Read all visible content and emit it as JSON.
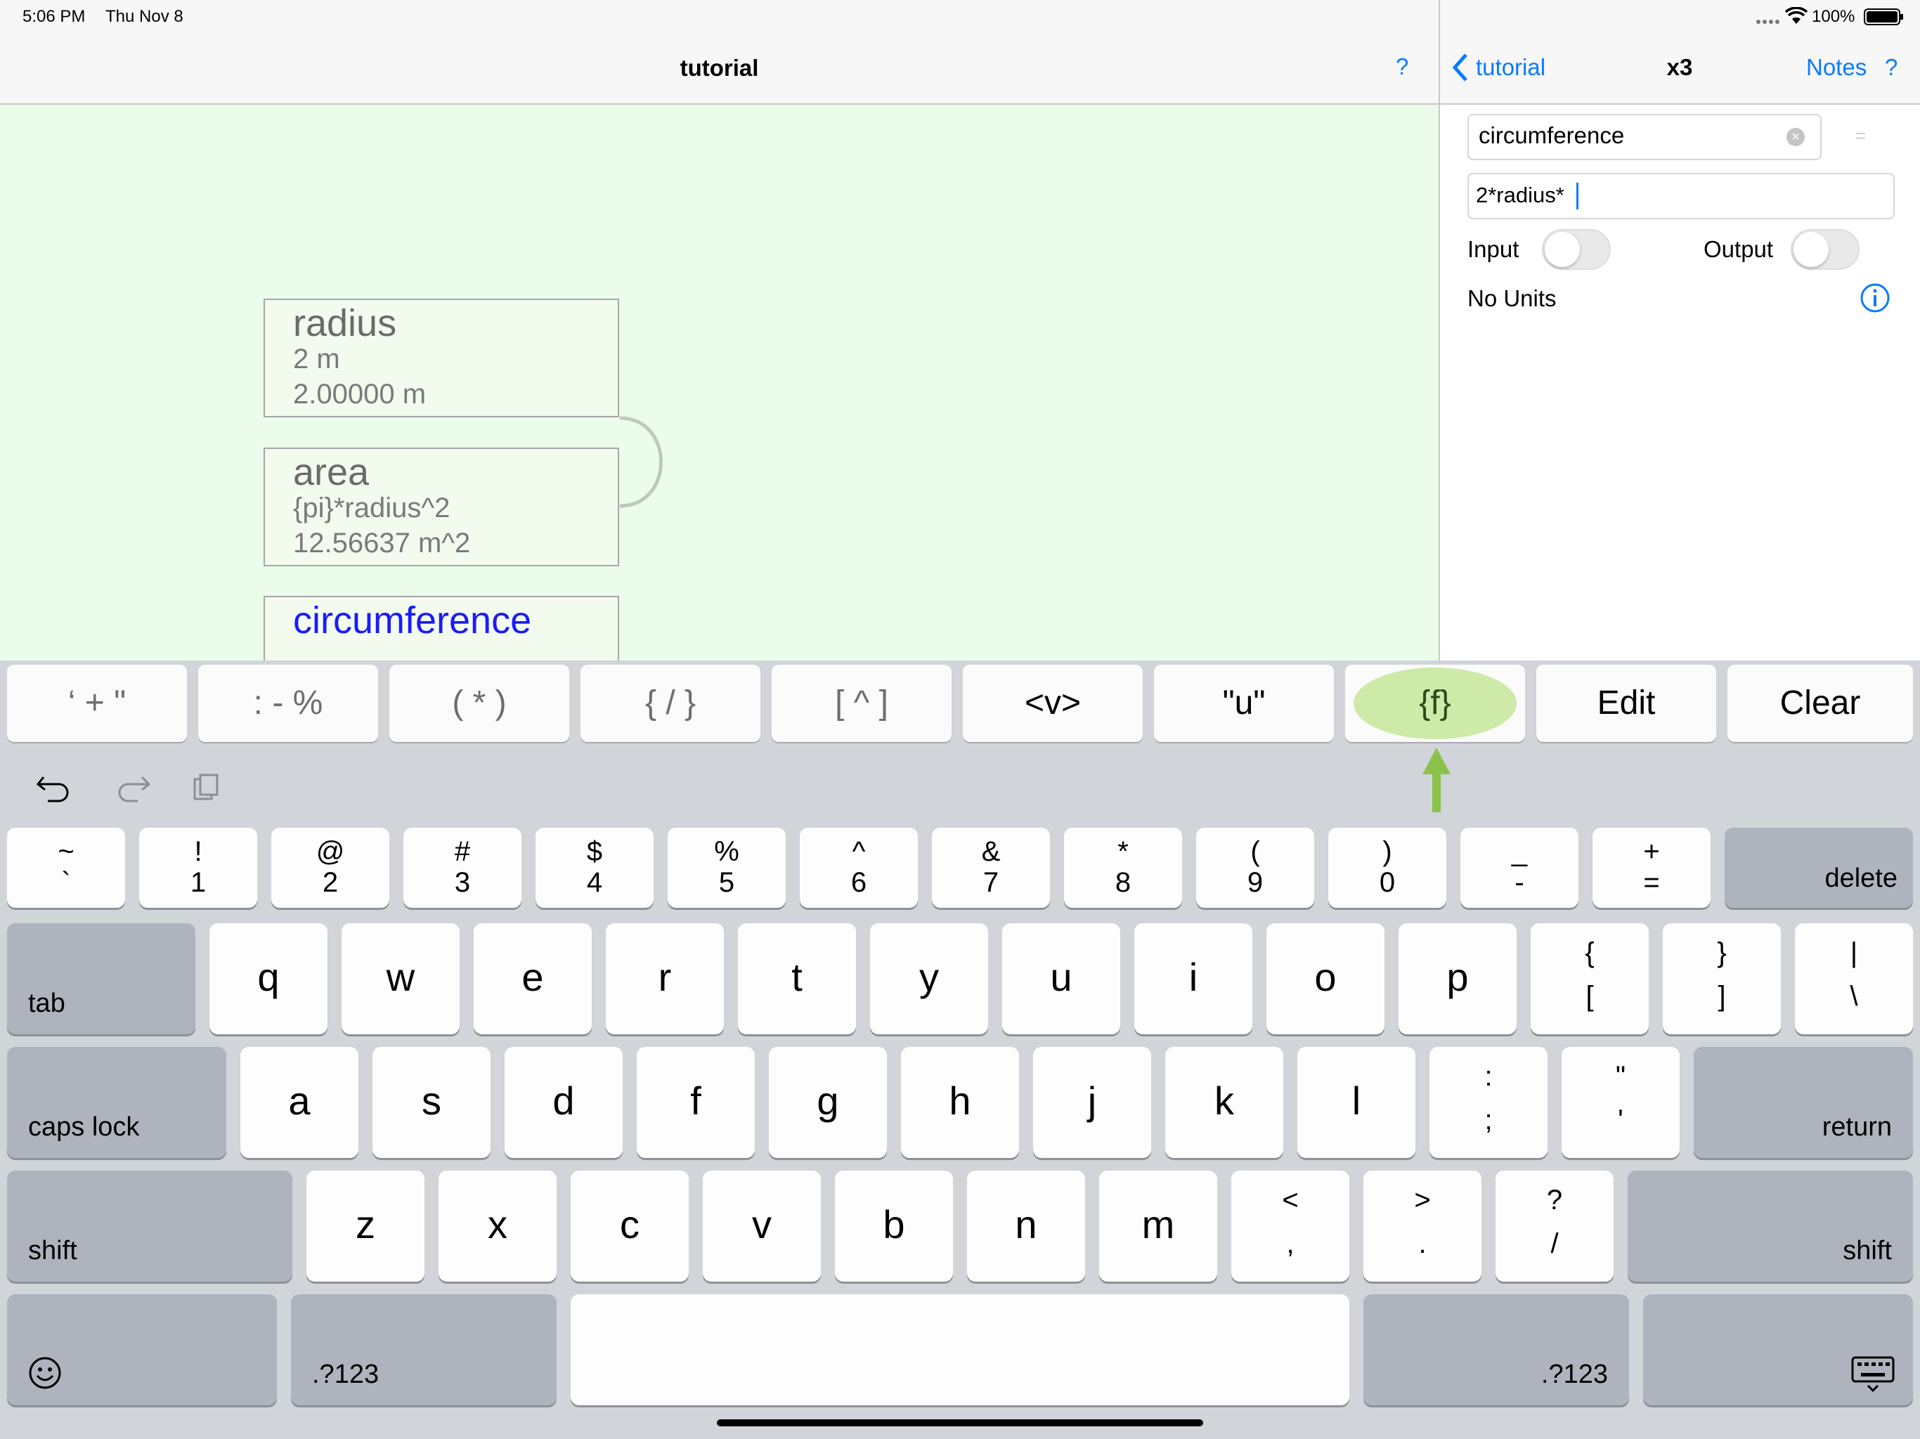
{
  "status": {
    "time": "5:06 PM",
    "date": "Thu Nov 8",
    "battery": "100%"
  },
  "left_nav": {
    "title": "tutorial",
    "help": "?"
  },
  "right_nav": {
    "back_label": "tutorial",
    "title": "x3",
    "notes_label": "Notes",
    "help": "?"
  },
  "editor": {
    "name_value": "circumference",
    "equals": "=",
    "expression_value": "2*radius*",
    "input_label": "Input",
    "output_label": "Output",
    "units_label": "No Units"
  },
  "nodes": [
    {
      "name": "radius",
      "line1": "2 m",
      "line2": "2.00000 m"
    },
    {
      "name": "area",
      "line1": "{pi}*radius^2",
      "line2": "12.56637 m^2"
    },
    {
      "name": "circumference"
    }
  ],
  "accessory_keys": [
    "‘ + \"",
    ": - %",
    "( * )",
    "{ / }",
    "[ ^ ]",
    "<v>",
    "\"u\"",
    "{f}",
    "Edit",
    "Clear"
  ],
  "keyboard": {
    "num_row": [
      {
        "top": "~",
        "bot": "`"
      },
      {
        "top": "!",
        "bot": "1"
      },
      {
        "top": "@",
        "bot": "2"
      },
      {
        "top": "#",
        "bot": "3"
      },
      {
        "top": "$",
        "bot": "4"
      },
      {
        "top": "%",
        "bot": "5"
      },
      {
        "top": "^",
        "bot": "6"
      },
      {
        "top": "&",
        "bot": "7"
      },
      {
        "top": "*",
        "bot": "8"
      },
      {
        "top": "(",
        "bot": "9"
      },
      {
        "top": ")",
        "bot": "0"
      },
      {
        "top": "_",
        "bot": "-"
      },
      {
        "top": "+",
        "bot": "="
      }
    ],
    "delete": "delete",
    "tab": "tab",
    "row_q": [
      "q",
      "w",
      "e",
      "r",
      "t",
      "y",
      "u",
      "i",
      "o",
      "p"
    ],
    "row_q_sym": [
      {
        "top": "{",
        "bot": "["
      },
      {
        "top": "}",
        "bot": "]"
      },
      {
        "top": "|",
        "bot": "\\"
      }
    ],
    "caps": "caps lock",
    "row_a": [
      "a",
      "s",
      "d",
      "f",
      "g",
      "h",
      "j",
      "k",
      "l"
    ],
    "row_a_sym": [
      {
        "top": ":",
        "bot": ";"
      },
      {
        "top": "\"",
        "bot": "'"
      }
    ],
    "return": "return",
    "shift": "shift",
    "row_z": [
      "z",
      "x",
      "c",
      "v",
      "b",
      "n",
      "m"
    ],
    "row_z_sym": [
      {
        "top": "<",
        "bot": ","
      },
      {
        "top": ">",
        "bot": "."
      },
      {
        "top": "?",
        "bot": "/"
      }
    ],
    "numbers_label": ".?123"
  },
  "colors": {
    "accent": "#0a7aff",
    "highlight": "#cdeaa8",
    "arrow": "#8bc34a",
    "link_node": "#1a1aff"
  }
}
